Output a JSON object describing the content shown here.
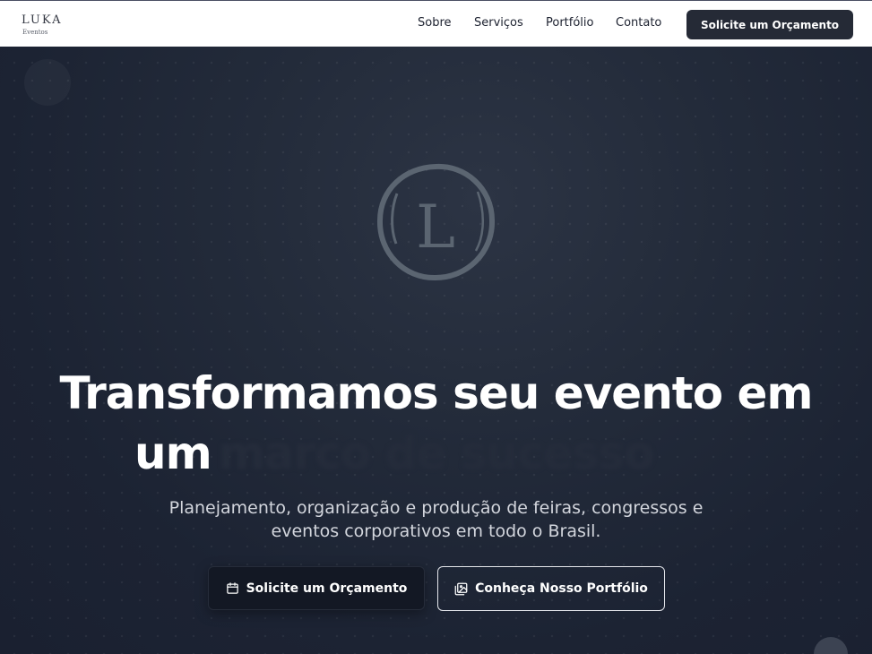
{
  "brand": {
    "name": "LUKA",
    "tagline": "Eventos",
    "emblem_letter": "L"
  },
  "nav": {
    "links": [
      {
        "label": "Sobre"
      },
      {
        "label": "Serviços"
      },
      {
        "label": "Portfólio"
      },
      {
        "label": "Contato"
      }
    ],
    "cta_label": "Solicite um Orçamento"
  },
  "hero": {
    "headline_line1": "Transformamos seu evento em",
    "headline_line2_prefix": "um",
    "headline_line2_highlight": "marco de sucesso",
    "subtitle": "Planejamento, organização e produção de feiras, congressos e eventos corporativos em todo o Brasil.",
    "primary_button": {
      "label": "Solicite um Orçamento",
      "icon": "calendar-icon"
    },
    "secondary_button": {
      "label": "Conheça Nosso Portfólio",
      "icon": "image-gallery-icon"
    }
  },
  "colors": {
    "navbar_bg": "#ffffff",
    "hero_bg": "#1c2333",
    "cta_bg": "#252a36",
    "text_light": "#ffffff",
    "subtitle": "#d3d6dd"
  }
}
